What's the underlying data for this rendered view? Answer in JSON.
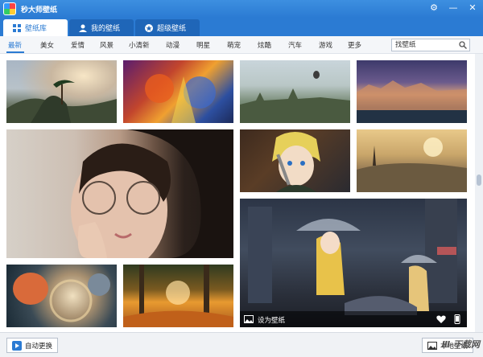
{
  "app": {
    "title": "秒大师壁纸"
  },
  "tabs": [
    {
      "label": "壁纸库"
    },
    {
      "label": "我的壁纸"
    },
    {
      "label": "超级壁纸"
    }
  ],
  "categories": [
    "最新",
    "美女",
    "爱情",
    "风景",
    "小清新",
    "动漫",
    "明星",
    "萌宠",
    "炫酷",
    "汽车",
    "游戏",
    "更多"
  ],
  "search": {
    "value": "找壁纸"
  },
  "overlay": {
    "set_label": "设为壁纸"
  },
  "bottom": {
    "auto_label": "自动更换",
    "local_label": "本地壁纸"
  },
  "watermark": "Ⅲ 下载网",
  "colors": {
    "accent": "#2b7bd3"
  }
}
